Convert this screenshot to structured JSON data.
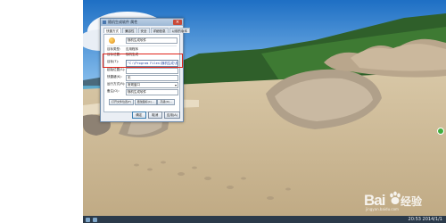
{
  "dialog": {
    "title": "随机生成软件 属性",
    "close_label": "×",
    "tabs": [
      {
        "label": "快捷方式"
      },
      {
        "label": "兼容性"
      },
      {
        "label": "安全"
      },
      {
        "label": "详细信息"
      },
      {
        "label": "以前的版本"
      }
    ],
    "name_value": "随机生成软件",
    "fields": {
      "target_type_label": "目标类型:",
      "target_type_value": "应用程序",
      "target_location_label": "目标位置:",
      "target_location_value": "随机生成",
      "target_label": "目标(T):",
      "target_value": "\"C:\\Program Files\\随机生成\\随机生成软件.exe\"",
      "start_in_label": "起始位置(S):",
      "shortcut_key_label": "快捷键(K):",
      "shortcut_key_value": "无",
      "run_label": "运行方式(R):",
      "run_value": "常规窗口",
      "comment_label": "备注(O):",
      "comment_value": "随机生成软件"
    },
    "buttons": {
      "open_location": "打开文件位置(F)",
      "change_icon": "更改图标(C)...",
      "advanced": "高级(D)...",
      "ok": "确定",
      "cancel": "取消",
      "apply": "应用(A)"
    }
  },
  "watermark": {
    "bai": "Bai",
    "du": "du",
    "jingyan": "经验",
    "url": "jingyan.baidu.com"
  },
  "taskbar": {
    "clock": "20:53 2014/1/1"
  }
}
